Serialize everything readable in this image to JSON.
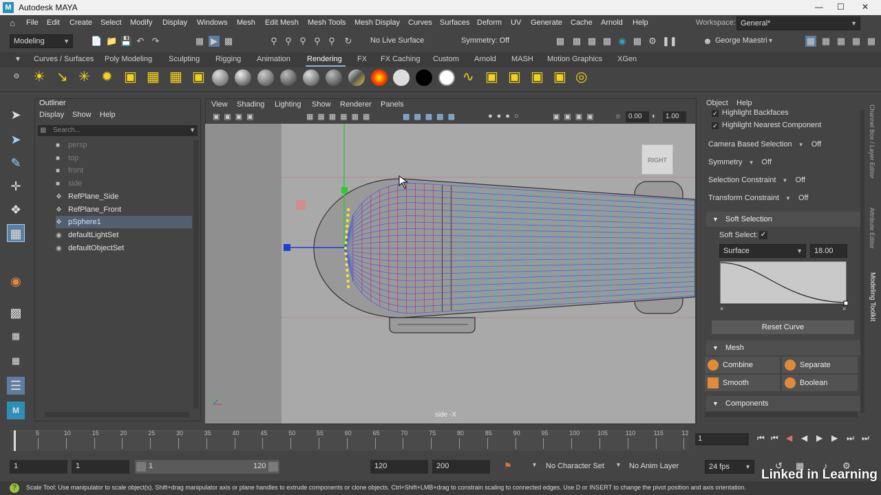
{
  "app": {
    "title": "Autodesk MAYA",
    "logo": "M"
  },
  "menus": [
    "File",
    "Edit",
    "Create",
    "Select",
    "Modify",
    "Display",
    "Windows",
    "Mesh",
    "Edit Mesh",
    "Mesh Tools",
    "Mesh Display",
    "Curves",
    "Surfaces",
    "Deform",
    "UV",
    "Generate",
    "Cache",
    "Arnold",
    "Help"
  ],
  "workspace": {
    "label": "Workspace:",
    "value": "General*"
  },
  "status": {
    "mode": "Modeling",
    "live_surface": "No Live Surface",
    "symmetry": "Symmetry: Off",
    "user": "George Maestri"
  },
  "shelf_tabs": [
    "Curves / Surfaces",
    "Poly Modeling",
    "Sculpting",
    "Rigging",
    "Animation",
    "Rendering",
    "FX",
    "FX Caching",
    "Custom",
    "Arnold",
    "MASH",
    "Motion Graphics",
    "XGen"
  ],
  "shelf_active": "Rendering",
  "outliner": {
    "title": "Outliner",
    "menu": [
      "Display",
      "Show",
      "Help"
    ],
    "search_placeholder": "Search...",
    "items": [
      {
        "label": "persp",
        "dim": true,
        "icon": "camera-icon"
      },
      {
        "label": "top",
        "dim": true,
        "icon": "camera-icon"
      },
      {
        "label": "front",
        "dim": true,
        "icon": "camera-icon"
      },
      {
        "label": "side",
        "dim": true,
        "icon": "camera-icon"
      },
      {
        "label": "RefPlane_Side",
        "dim": false,
        "icon": "transform-icon"
      },
      {
        "label": "RefPlane_Front",
        "dim": false,
        "icon": "transform-icon"
      },
      {
        "label": "pSphere1",
        "dim": false,
        "icon": "transform-icon",
        "selected": true
      },
      {
        "label": "defaultLightSet",
        "dim": false,
        "icon": "set-icon"
      },
      {
        "label": "defaultObjectSet",
        "dim": false,
        "icon": "set-icon"
      }
    ]
  },
  "viewport": {
    "menu": [
      "View",
      "Shading",
      "Lighting",
      "Show",
      "Renderer",
      "Panels"
    ],
    "field1": "0.00",
    "field2": "1.00",
    "camera_label": "side -X",
    "cube_label": "RIGHT"
  },
  "attr": {
    "menu": [
      "Object",
      "Help"
    ],
    "check1": "Highlight Backfaces",
    "check2": "Highlight Nearest Component",
    "rows": [
      {
        "label": "Camera Based Selection",
        "value": "Off"
      },
      {
        "label": "Symmetry",
        "value": "Off"
      },
      {
        "label": "Selection Constraint",
        "value": "Off"
      },
      {
        "label": "Transform Constraint",
        "value": "Off"
      }
    ],
    "soft_section": "Soft Selection",
    "soft_select_label": "Soft Select:",
    "falloff_mode": "Surface",
    "falloff_radius": "18.00",
    "reset_curve": "Reset Curve",
    "mesh_section": "Mesh",
    "mesh_buttons": [
      "Combine",
      "Separate",
      "Smooth",
      "Boolean"
    ],
    "components_section": "Components"
  },
  "side_tabs": [
    "Channel Box / Layer Editor",
    "Attribute Editor",
    "Modeling Toolkit"
  ],
  "timeline": {
    "ticks": [
      "5",
      "10",
      "15",
      "20",
      "25",
      "30",
      "35",
      "40",
      "45",
      "50",
      "55",
      "60",
      "65",
      "70",
      "75",
      "80",
      "85",
      "90",
      "95",
      "100",
      "105",
      "110",
      "115",
      "12"
    ],
    "current_frame": "1"
  },
  "range": {
    "start": "1",
    "playback_start": "1",
    "slider_start": "1",
    "slider_end": "120",
    "playback_end": "120",
    "end": "200",
    "character_set": "No Character Set",
    "anim_layer": "No Anim Layer",
    "fps": "24 fps"
  },
  "help_text": "Scale Tool: Use manipulator to scale object(s). Shift+drag manipulator axis or plane handles to extrude components or clone objects. Ctrl+Shift+LMB+drag to constrain scaling to connected edges. Use D or INSERT to change the pivot position and axis orientation.",
  "watermark": "Linked in Learning"
}
